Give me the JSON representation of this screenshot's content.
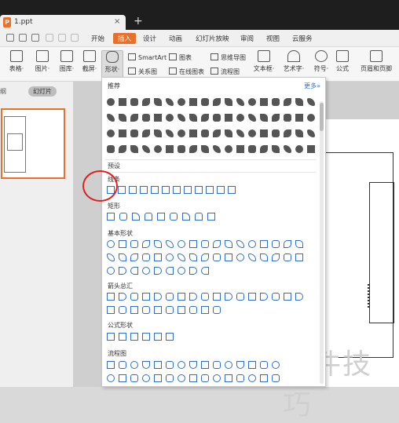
{
  "titlebar": {
    "file_name": "1.ppt",
    "logo": "P",
    "close": "×",
    "add": "+"
  },
  "menubar": {
    "items": [
      "开始",
      "插入",
      "设计",
      "动画",
      "幻灯片放映",
      "审阅",
      "视图",
      "云服务"
    ],
    "active": "插入"
  },
  "ribbon": {
    "table": "表格·",
    "picture": "图片·",
    "gallery": "图库·",
    "screenshot": "截屏·",
    "shape": "形状·",
    "smartart": "SmartArt",
    "chart": "图表",
    "mindmap": "思维导图",
    "relation": "关系图",
    "online_chart": "在线图表",
    "flowchart": "流程图",
    "textbox": "文本框·",
    "art": "艺术字·",
    "symbol": "符号·",
    "formula": "公式",
    "header": "页眉和页脚"
  },
  "left": {
    "tab1": "纲",
    "tab2": "幻灯片"
  },
  "popup": {
    "recommended": "推荐",
    "more": "更多»",
    "preset": "预设",
    "lines": "线条",
    "rect": "矩形",
    "basic": "基本形状",
    "arrows": "箭头总汇",
    "formula_shapes": "公式形状",
    "flow": "流程图"
  },
  "watermark": "软件技巧",
  "colors": {
    "accent": "#e8702a",
    "shape_blue": "#2e6ec9",
    "highlight": "#e02020"
  }
}
